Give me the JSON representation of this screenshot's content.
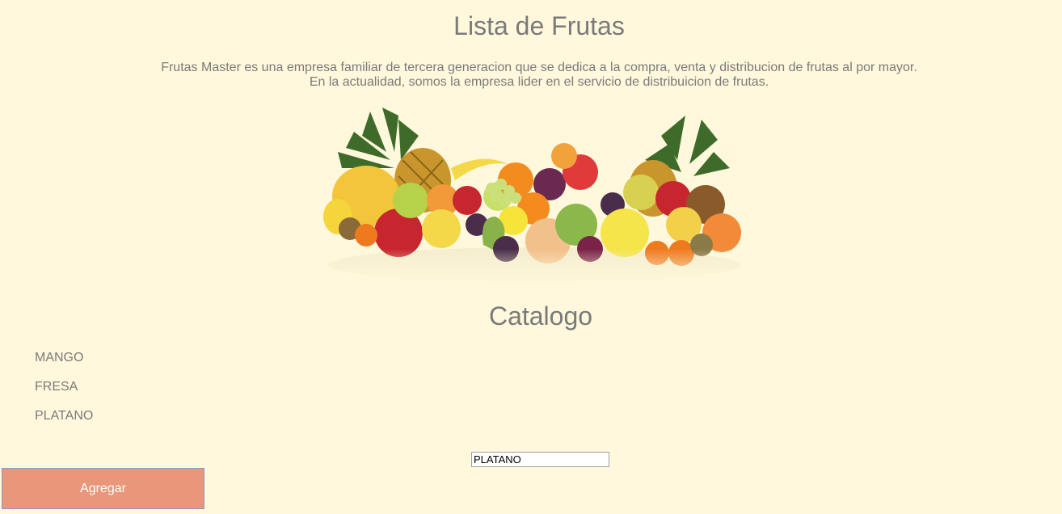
{
  "header": {
    "title": "Lista de Frutas",
    "description_line1": "Frutas Master es una empresa familiar de tercera generacion que se dedica a la compra, venta y distribucion de frutas al por mayor.",
    "description_line2": "En la actualidad, somos la empresa lider en el servicio de distribuicion de frutas."
  },
  "hero_image": {
    "icon": "fruit-assortment-image"
  },
  "catalog": {
    "title": "Catalogo",
    "items": [
      "MANGO",
      "FRESA",
      "PLATANO"
    ]
  },
  "form": {
    "input_value": "PLATANO",
    "button_label": "Agregar",
    "button_color": "#e9967a"
  },
  "colors": {
    "background": "#fff8dc",
    "text": "#7a7a7a"
  }
}
